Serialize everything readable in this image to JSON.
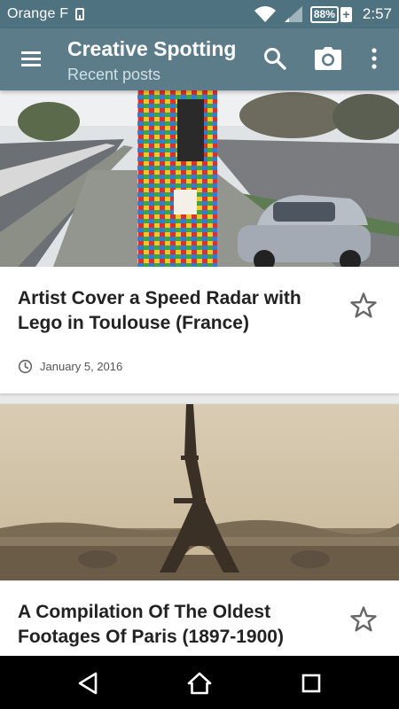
{
  "status_bar": {
    "carrier": "Orange F",
    "battery": "88%",
    "battery_plus": "+",
    "time": "2:57",
    "icons": [
      "sim-icon",
      "wifi-icon",
      "signal-icon",
      "battery-icon"
    ]
  },
  "app_bar": {
    "title": "Creative Spotting",
    "subtitle": "Recent posts",
    "icons": [
      "menu-icon",
      "search-icon",
      "camera-icon",
      "more-vert-icon"
    ]
  },
  "posts": [
    {
      "title": "Artist Cover a Speed Radar with Lego in Toulouse (France)",
      "date": "January 5, 2016",
      "image": "lego-covered-speed-radar-photo",
      "starred": false
    },
    {
      "title": "A Compilation Of The Oldest Footages Of Paris (1897-1900)",
      "image": "vintage-eiffel-tower-photo",
      "starred": false
    }
  ],
  "nav_bar": {
    "icons": [
      "back-icon",
      "home-icon",
      "recents-icon"
    ]
  },
  "colors": {
    "status_bar": "#4f7280",
    "app_bar": "#5c7c89",
    "background": "#e9e9e9",
    "card": "#ffffff",
    "title_text": "#222222"
  }
}
